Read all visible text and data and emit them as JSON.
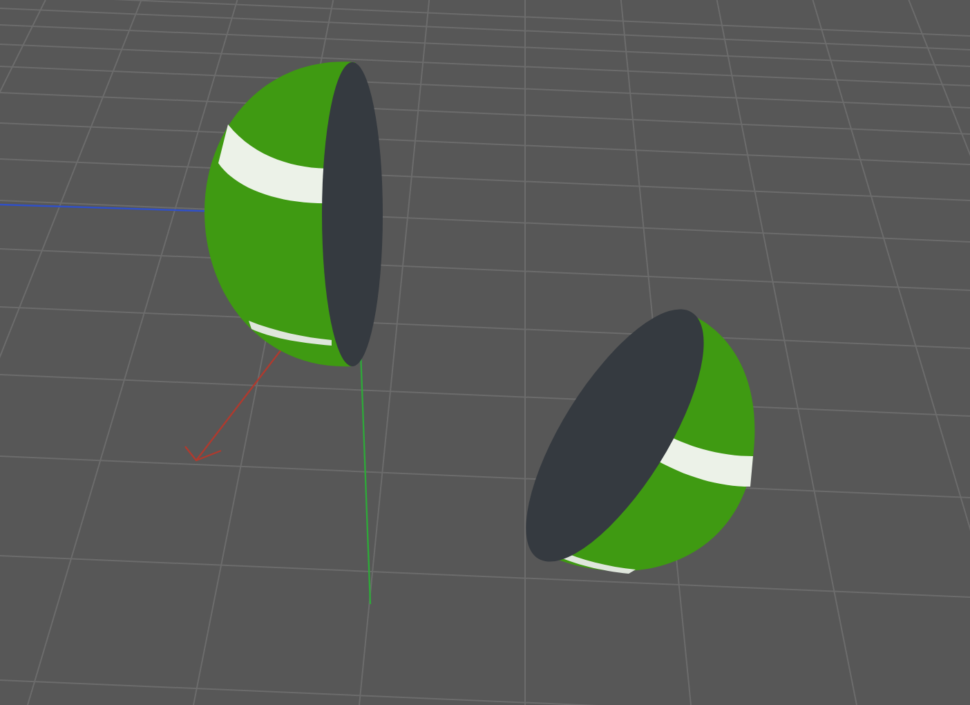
{
  "viewport": {
    "objects": [
      {
        "kind": "hemisphere"
      },
      {
        "kind": "hemisphere"
      }
    ]
  }
}
